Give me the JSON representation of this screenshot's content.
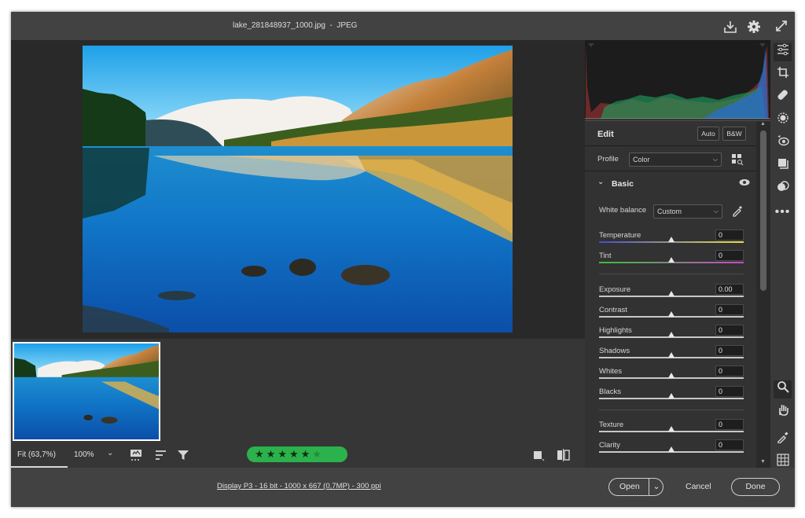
{
  "title": "lake_281848937_1000.jpg  -  JPEG",
  "titlebar_icons": [
    "download-icon",
    "gear-icon",
    "expand-icon"
  ],
  "canvas": {
    "fit_label": "Fit (63,7%)",
    "zoom_value": "100%"
  },
  "rating": {
    "stars": 5,
    "max": 6
  },
  "status": {
    "info": "Display P3 - 16 bit - 1000 x 667 (0,7MP) - 300 ppi"
  },
  "buttons": {
    "open": "Open",
    "cancel": "Cancel",
    "done": "Done"
  },
  "panel": {
    "edit_title": "Edit",
    "auto": "Auto",
    "bw": "B&W",
    "profile_label": "Profile",
    "profile_value": "Color",
    "basic_title": "Basic",
    "wb_label": "White balance",
    "wb_value": "Custom",
    "sliders": [
      {
        "label": "Temperature",
        "value": "0",
        "position": 0.5
      },
      {
        "label": "Tint",
        "value": "0",
        "position": 0.5
      },
      {
        "label": "Exposure",
        "value": "0.00",
        "position": 0.5
      },
      {
        "label": "Contrast",
        "value": "0",
        "position": 0.5
      },
      {
        "label": "Highlights",
        "value": "0",
        "position": 0.5
      },
      {
        "label": "Shadows",
        "value": "0",
        "position": 0.5
      },
      {
        "label": "Whites",
        "value": "0",
        "position": 0.5
      },
      {
        "label": "Blacks",
        "value": "0",
        "position": 0.5
      },
      {
        "label": "Texture",
        "value": "0",
        "position": 0.5
      },
      {
        "label": "Clarity",
        "value": "0",
        "position": 0.5
      }
    ]
  },
  "tools": [
    "adjust-sliders-icon",
    "crop-icon",
    "healing-brush-icon",
    "mask-icon",
    "redeye-icon",
    "snapshots-icon",
    "presets-icon",
    "more-icon",
    "zoom-icon",
    "hand-icon",
    "eyedropper-icon",
    "grid-icon"
  ]
}
